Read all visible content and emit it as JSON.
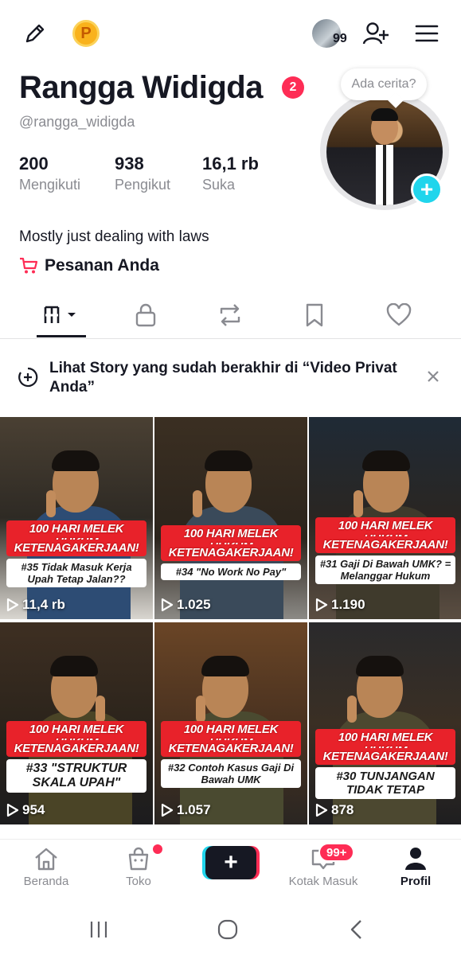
{
  "topbar": {
    "friend_count": "99"
  },
  "profile": {
    "name": "Rangga Widigda",
    "badge_count": "2",
    "username": "@rangga_widigda",
    "story_prompt": "Ada cerita?",
    "bio": "Mostly just dealing with laws",
    "orders_label": "Pesanan Anda"
  },
  "stats": [
    {
      "value": "200",
      "label": "Mengikuti"
    },
    {
      "value": "938",
      "label": "Pengikut"
    },
    {
      "value": "16,1 rb",
      "label": "Suka"
    }
  ],
  "story_banner": {
    "text": "Lihat Story yang sudah berakhir di “Video Privat Anda”"
  },
  "videos": [
    {
      "title": "100 HARI MELEK HUKUM",
      "subtitle": "KETENAGAKERJAAN!",
      "topic": "#35 Tidak Masuk Kerja Upah Tetap Jalan??",
      "views": "11,4 rb"
    },
    {
      "title": "100 HARI MELEK HUKUM",
      "subtitle": "KETENAGAKERJAAN!",
      "topic": "#34 \"No Work No Pay\"",
      "views": "1.025"
    },
    {
      "title": "100 HARI MELEK HUKUM",
      "subtitle": "KETENAGAKERJAAN!",
      "topic": "#31 Gaji Di Bawah UMK? = Melanggar Hukum",
      "views": "1.190"
    },
    {
      "title": "100 HARI MELEK HUKUM",
      "subtitle": "KETENAGAKERJAAN!",
      "topic": "#33 \"STRUKTUR SKALA UPAH\"",
      "views": "954"
    },
    {
      "title": "100 HARI MELEK HUKUM",
      "subtitle": "KETENAGAKERJAAN!",
      "topic": "#32 Contoh Kasus Gaji Di Bawah UMK",
      "views": "1.057"
    },
    {
      "title": "100 HARI MELEK HUKUM",
      "subtitle": "KETENAGAKERJAAN!",
      "topic": "#30 TUNJANGAN TIDAK TETAP",
      "views": "878"
    }
  ],
  "bottom_nav": {
    "home": "Beranda",
    "shop": "Toko",
    "inbox": "Kotak Masuk",
    "inbox_badge": "99+",
    "profile": "Profil"
  },
  "colors": {
    "accent": "#fe2c55",
    "cyan": "#20d5ec",
    "text": "#161823",
    "muted": "#8a8b91"
  }
}
